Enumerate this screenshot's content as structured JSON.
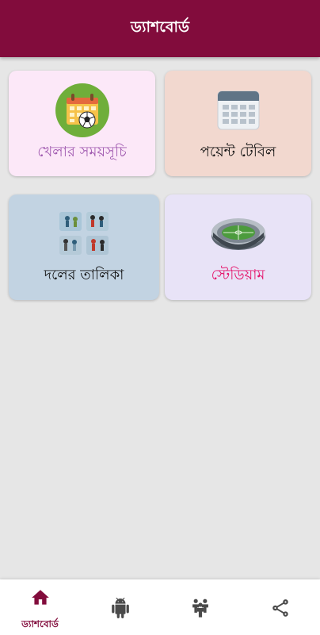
{
  "app_bar": {
    "title": "ড্যাশবোর্ড"
  },
  "cards": [
    {
      "label": "খেলার সময়সূচি",
      "icon": "calendar-soccer-icon",
      "background": "#fce8f8",
      "text_color": "#a05ab0"
    },
    {
      "label": "পয়েন্ট টেবিল",
      "icon": "calendar-table-icon",
      "background": "#f2d8cf",
      "text_color": "#111111"
    },
    {
      "label": "দলের তালিকা",
      "icon": "team-players-icon",
      "background": "#c2d3e2",
      "text_color": "#111111"
    },
    {
      "label": "স্টেডিয়াম",
      "icon": "stadium-icon",
      "background": "#e8e3f7",
      "text_color": "#e5136a"
    }
  ],
  "bottom_nav": {
    "items": [
      {
        "label": "ড্যাশবোর্ড",
        "icon": "home-icon",
        "selected": true
      },
      {
        "label": "",
        "icon": "android-icon",
        "selected": false
      },
      {
        "label": "",
        "icon": "group-icon",
        "selected": false
      },
      {
        "label": "",
        "icon": "share-icon",
        "selected": false
      }
    ]
  },
  "colors": {
    "primary": "#820c3c",
    "background": "#e6e6e6",
    "icon_inactive": "#4a4a4a"
  }
}
